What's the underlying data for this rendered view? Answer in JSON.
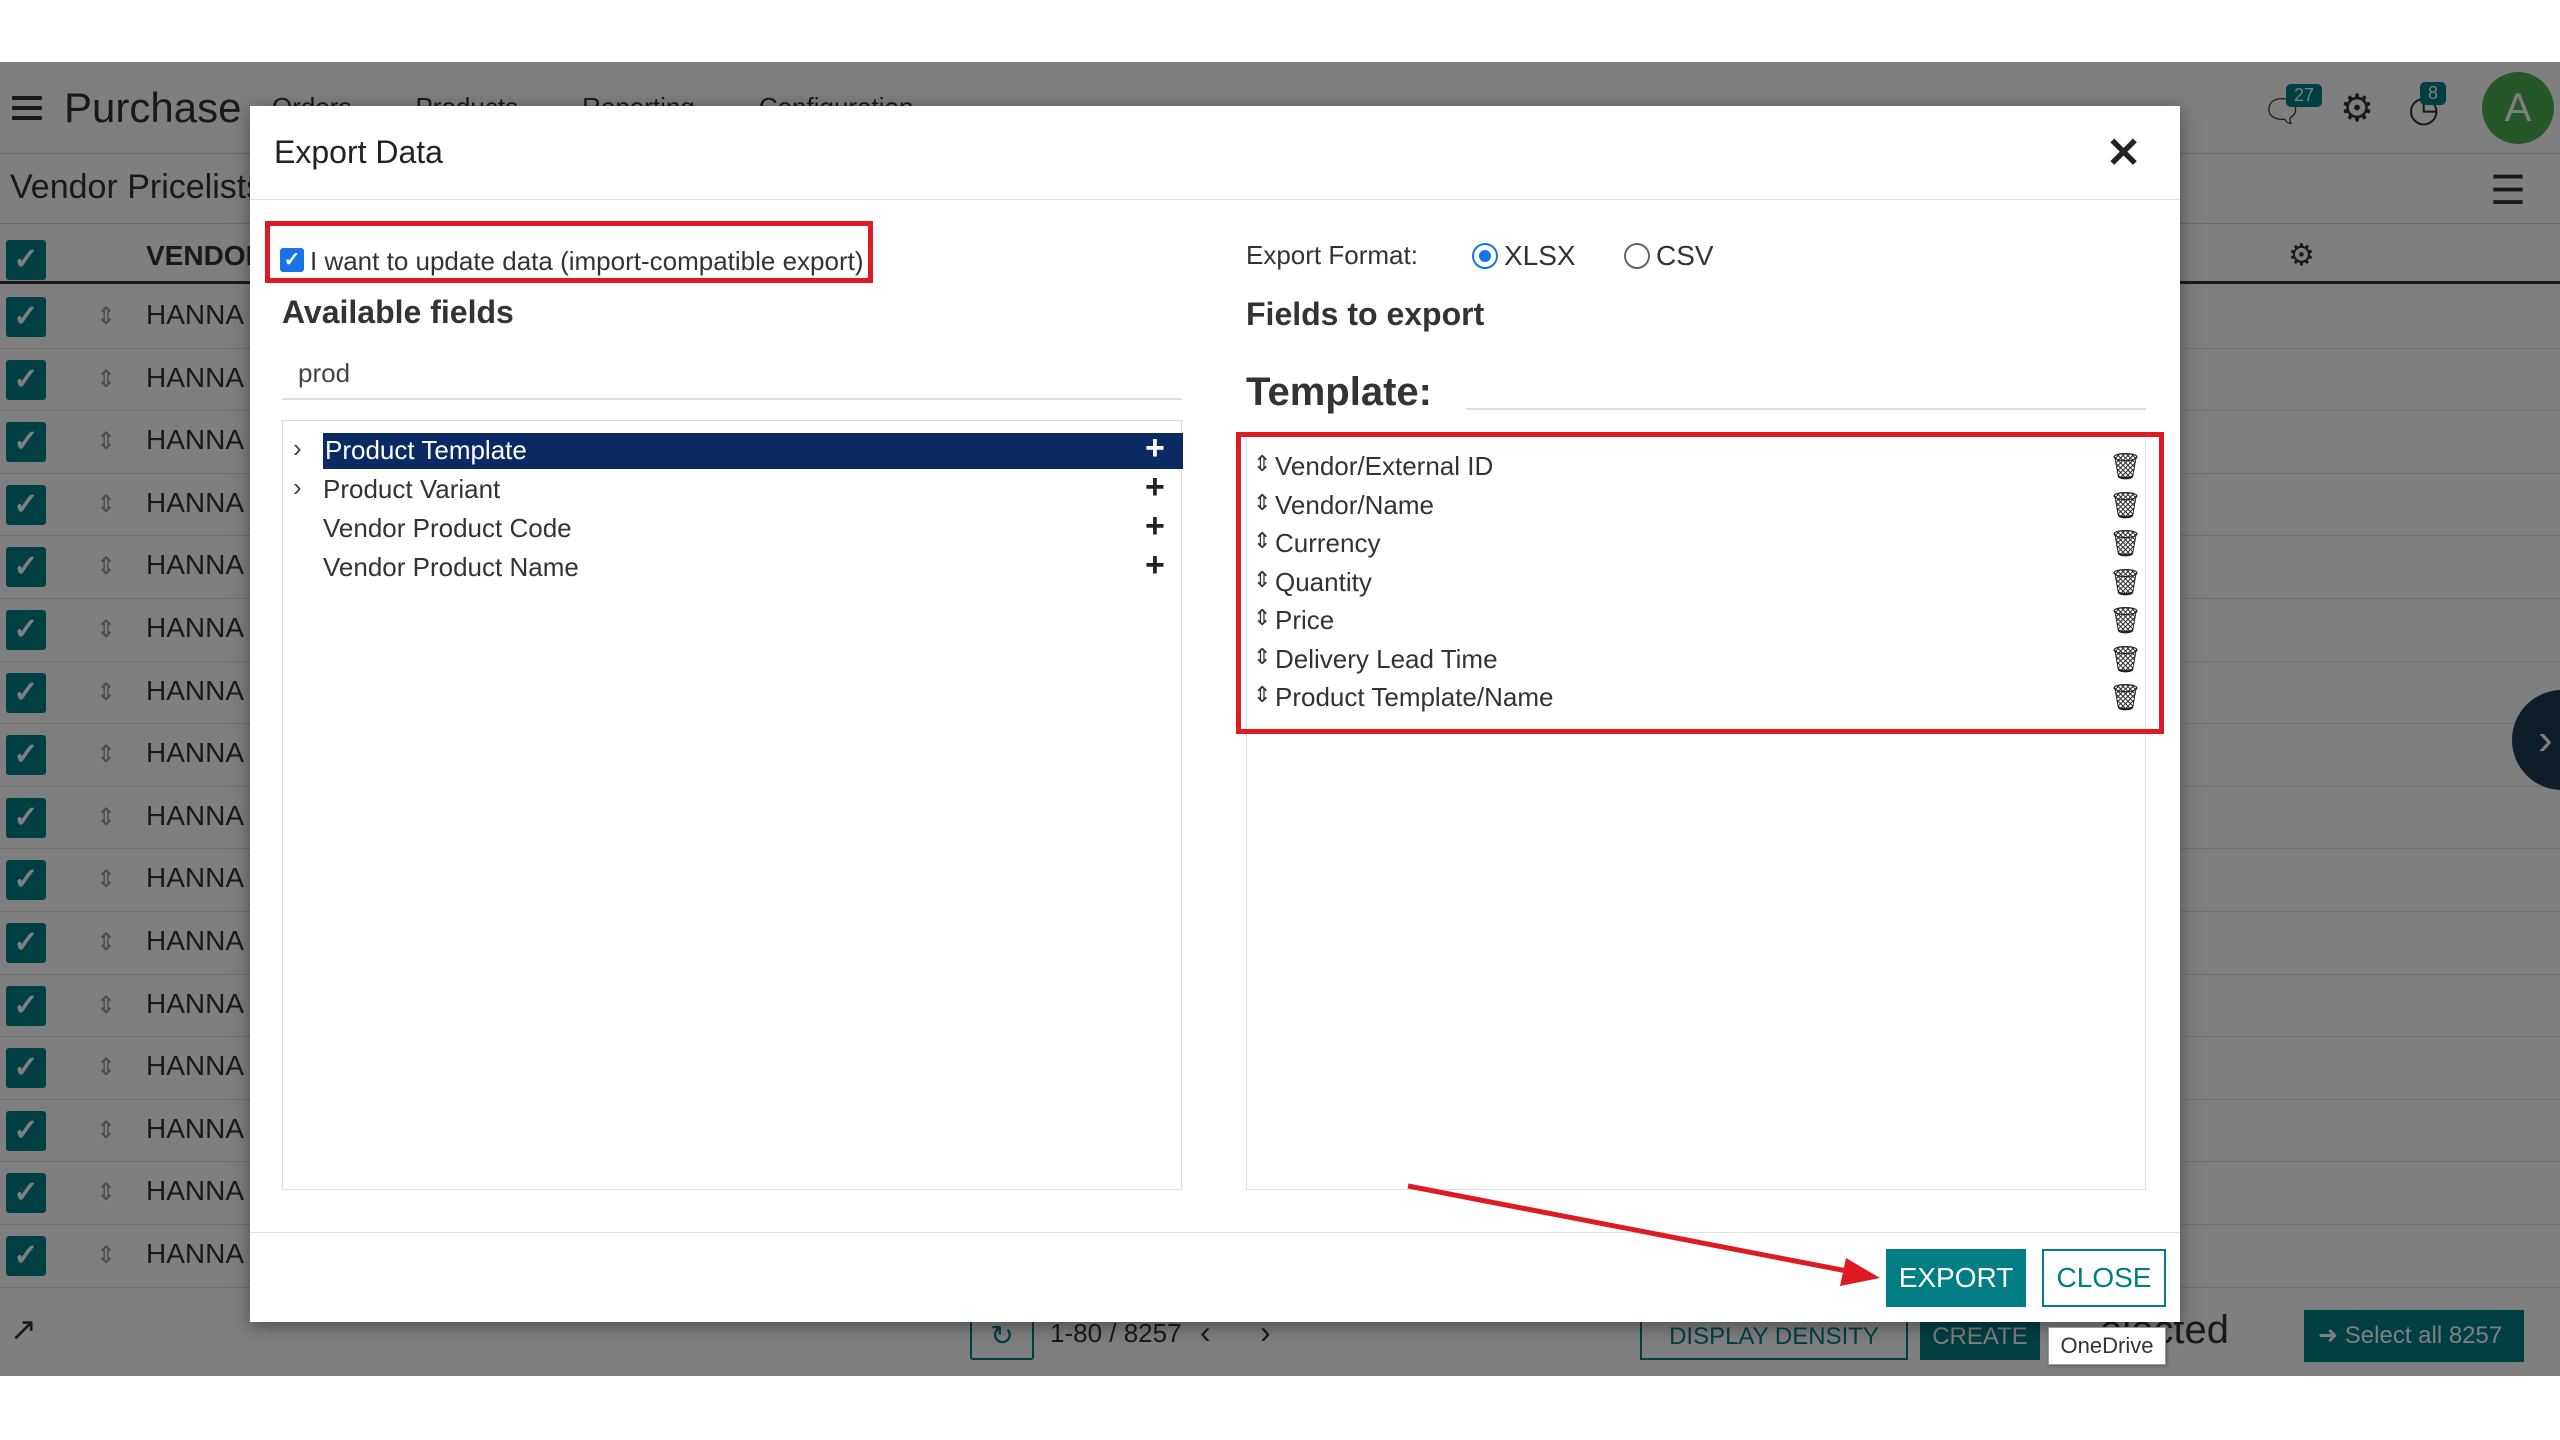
{
  "app": {
    "name": "Purchase",
    "menu": [
      "Orders",
      "Products",
      "Reporting",
      "Configuration"
    ],
    "messages_badge": "27",
    "activities_badge": "8",
    "avatar_letter": "A"
  },
  "breadcrumb": "Vendor Pricelists",
  "list": {
    "vendor_header": "VENDOR",
    "rows": [
      "HANNA I",
      "HANNA I",
      "HANNA I",
      "HANNA I",
      "HANNA I",
      "HANNA I",
      "HANNA I",
      "HANNA I",
      "HANNA I",
      "HANNA I",
      "HANNA I",
      "HANNA I",
      "HANNA I",
      "HANNA I",
      "HANNA I",
      "HANNA I"
    ]
  },
  "pager": {
    "value": "1-80 / 8257",
    "display_density_label": "DISPLAY DENSITY",
    "create_label": "CREATE",
    "selected_text": "elected",
    "select_all_label": "Select all 8257"
  },
  "dialog": {
    "title": "Export Data",
    "import_compatible_label": "I want to update data (import-compatible export)",
    "import_compatible_checked": true,
    "available_fields_title": "Available fields",
    "search_value": "prod",
    "available_fields": [
      {
        "label": "Product Template",
        "expandable": true,
        "selected": true
      },
      {
        "label": "Product Variant",
        "expandable": true,
        "selected": false
      },
      {
        "label": "Vendor Product Code",
        "expandable": false,
        "selected": false
      },
      {
        "label": "Vendor Product Name",
        "expandable": false,
        "selected": false
      }
    ],
    "export_format_label": "Export Format:",
    "formats": [
      {
        "label": "XLSX",
        "checked": true
      },
      {
        "label": "CSV",
        "checked": false
      }
    ],
    "fields_to_export_title": "Fields to export",
    "template_label": "Template:",
    "export_fields": [
      "Vendor/External ID",
      "Vendor/Name",
      "Currency",
      "Quantity",
      "Price",
      "Delivery Lead Time",
      "Product Template/Name"
    ],
    "export_button": "EXPORT",
    "close_button": "CLOSE"
  },
  "tooltip": "OneDrive",
  "icons": {
    "hamburger": "hamburger-menu-icon",
    "chat": "chat-icon",
    "gear": "gear-icon",
    "clock": "activity-clock-icon",
    "close": "close-icon",
    "plus": "plus-icon",
    "sort": "sort-handle-icon",
    "trash": "trash-icon",
    "chevron": "chevron-right-icon"
  },
  "colors": {
    "accent": "#017e84",
    "selected_field": "#0b2a63",
    "annotation_red": "#e01a22"
  }
}
